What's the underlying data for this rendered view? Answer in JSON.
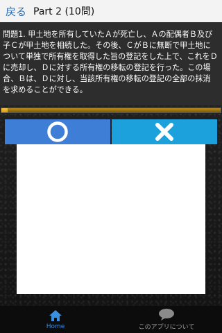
{
  "header": {
    "back_label": "戻る",
    "title": "Part 2 (10問)"
  },
  "question": {
    "text": "問題1. 甲土地を所有していたＡが死亡し、Ａの配偶者Ｂ及び子Ｃが甲土地を相続した。その後、ＣがＢに無断で甲土地について単独で所有権を取得した旨の登記をした上で、これをＤに売却し、Ｄに対する所有権の移転の登記を行った。この場合、Ｂは、Ｄに対し、当該所有権の移転の登記の全部の抹消を求めることができる。"
  },
  "progress": {
    "value": 0.03
  },
  "answers": {
    "correct_icon": "circle-icon",
    "wrong_icon": "cross-icon"
  },
  "bottom_nav": {
    "items": [
      {
        "label": "Home",
        "icon": "home-icon"
      },
      {
        "label": "このアプリについて",
        "icon": "speech-bubble-icon"
      }
    ]
  },
  "colors": {
    "accent_blue": "#3f7ed6",
    "accent_cyan": "#1ca1dd",
    "progress_gold": "#e6a921"
  }
}
